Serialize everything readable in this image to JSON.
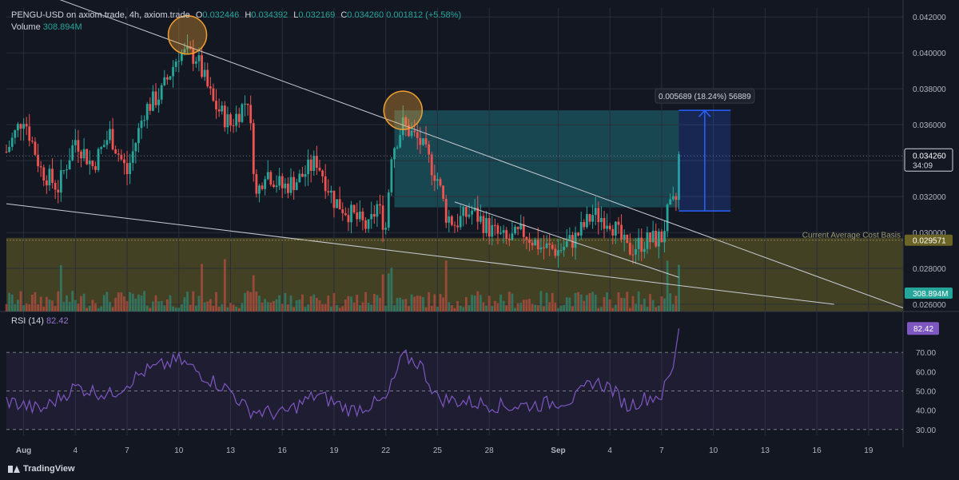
{
  "header": {
    "symbol": "PENGU-USD on axiom.trade, 4h, axiom.trade",
    "o_label": "O",
    "o_value": "0.032446",
    "h_label": "H",
    "h_value": "0.034392",
    "l_label": "L",
    "l_value": "0.032169",
    "c_label": "C",
    "c_value": "0.034260",
    "change_value": "0.001812 (+5.58%)",
    "volume_label": "Volume",
    "volume_value": "308.894M",
    "rsi_label": "RSI (14)",
    "rsi_value": "82.42"
  },
  "brand": {
    "name": "TradingView",
    "icon": "tradingview-logo-icon"
  },
  "colors": {
    "background": "#131722",
    "up": "#26a69a",
    "down": "#ef5350",
    "zone_cyan": "#1f6f78",
    "zone_yellow": "#6b6424",
    "rsi": "#7e57c2",
    "circle": "#f0a030",
    "measure": "#2962ff"
  },
  "chart_data": {
    "type": "candlestick",
    "symbol": "PENGU-USD",
    "interval": "4h",
    "price_axis": {
      "ticks": [
        0.026,
        0.028,
        0.03,
        0.032,
        0.034,
        0.036,
        0.038,
        0.04,
        0.042
      ],
      "tick_labels": [
        "0.026000",
        "0.028000",
        "0.030000",
        "0.032000",
        "0.034000",
        "0.036000",
        "0.038000",
        "0.040000",
        "0.042000"
      ],
      "range": [
        0.0256,
        0.0425
      ]
    },
    "time_axis": {
      "range": [
        "2025-07-31",
        "2025-09-21"
      ],
      "ticks": [
        {
          "date": "2025-08-01",
          "label": "Aug",
          "bold": true
        },
        {
          "date": "2025-08-04",
          "label": "4"
        },
        {
          "date": "2025-08-07",
          "label": "7"
        },
        {
          "date": "2025-08-10",
          "label": "10"
        },
        {
          "date": "2025-08-13",
          "label": "13"
        },
        {
          "date": "2025-08-16",
          "label": "16"
        },
        {
          "date": "2025-08-19",
          "label": "19"
        },
        {
          "date": "2025-08-22",
          "label": "22"
        },
        {
          "date": "2025-08-25",
          "label": "25"
        },
        {
          "date": "2025-08-28",
          "label": "28"
        },
        {
          "date": "2025-09-01",
          "label": "Sep",
          "bold": true
        },
        {
          "date": "2025-09-04",
          "label": "4"
        },
        {
          "date": "2025-09-07",
          "label": "7"
        },
        {
          "date": "2025-09-10",
          "label": "10"
        },
        {
          "date": "2025-09-13",
          "label": "13"
        },
        {
          "date": "2025-09-16",
          "label": "16"
        },
        {
          "date": "2025-09-19",
          "label": "19"
        }
      ]
    },
    "price_path": [
      [
        "2025-07-31",
        0.0345
      ],
      [
        "2025-08-01",
        0.0365
      ],
      [
        "2025-08-02",
        0.0335
      ],
      [
        "2025-08-03",
        0.0325
      ],
      [
        "2025-08-04",
        0.0352
      ],
      [
        "2025-08-05",
        0.0337
      ],
      [
        "2025-08-06",
        0.0355
      ],
      [
        "2025-08-07",
        0.0333
      ],
      [
        "2025-08-08",
        0.0368
      ],
      [
        "2025-08-09",
        0.0378
      ],
      [
        "2025-08-10",
        0.04
      ],
      [
        "2025-08-11",
        0.0398
      ],
      [
        "2025-08-12",
        0.0372
      ],
      [
        "2025-08-13",
        0.036
      ],
      [
        "2025-08-14",
        0.0375
      ],
      [
        "2025-08-14T12",
        0.032
      ],
      [
        "2025-08-15",
        0.0335
      ],
      [
        "2025-08-16",
        0.0325
      ],
      [
        "2025-08-17",
        0.033
      ],
      [
        "2025-08-18",
        0.034
      ],
      [
        "2025-08-19",
        0.0318
      ],
      [
        "2025-08-20",
        0.031
      ],
      [
        "2025-08-21",
        0.0302
      ],
      [
        "2025-08-21T12",
        0.0315
      ],
      [
        "2025-08-22",
        0.0303
      ],
      [
        "2025-08-22T08",
        0.0345
      ],
      [
        "2025-08-23",
        0.036
      ],
      [
        "2025-08-24",
        0.035
      ],
      [
        "2025-08-25",
        0.033
      ],
      [
        "2025-08-25T12",
        0.031
      ],
      [
        "2025-08-26",
        0.0305
      ],
      [
        "2025-08-27",
        0.0312
      ],
      [
        "2025-08-28",
        0.0302
      ],
      [
        "2025-08-29",
        0.0295
      ],
      [
        "2025-08-30",
        0.03
      ],
      [
        "2025-08-31",
        0.0292
      ],
      [
        "2025-09-01",
        0.029
      ],
      [
        "2025-09-02",
        0.0297
      ],
      [
        "2025-09-03",
        0.031
      ],
      [
        "2025-09-04",
        0.0307
      ],
      [
        "2025-09-05",
        0.029
      ],
      [
        "2025-09-06",
        0.0295
      ],
      [
        "2025-09-07",
        0.0297
      ],
      [
        "2025-09-07T08",
        0.031
      ],
      [
        "2025-09-07T20",
        0.0318
      ],
      [
        "2025-09-08",
        0.0342
      ]
    ],
    "volume_last": "308.894M",
    "current_price_label": "0.034260",
    "countdown_label": "34:09",
    "avg_cost_price": 0.029571,
    "avg_cost_label": "0.029571",
    "avg_cost_text": "Current Average Cost Basis",
    "peak_circles": [
      {
        "date": "2025-08-10T12",
        "price": 0.041
      },
      {
        "date": "2025-08-23",
        "price": 0.0368
      }
    ],
    "trendlines": [
      {
        "from": [
          "2025-08-03",
          0.043
        ],
        "to": [
          "2025-09-21",
          0.0258
        ]
      },
      {
        "from": [
          "2025-07-31",
          0.0316
        ],
        "to": [
          "2025-09-17",
          0.026
        ]
      },
      {
        "from": [
          "2025-08-26",
          0.0317
        ],
        "to": [
          "2025-09-08",
          0.0275
        ]
      }
    ],
    "zones": [
      {
        "name": "target",
        "x0": "2025-08-22T12",
        "x1": "2025-09-08",
        "y0": 0.0314,
        "y1": 0.0368
      },
      {
        "name": "avg-cost",
        "x0": "2025-07-31",
        "x1": "2025-09-21",
        "y0": 0.0256,
        "y1": 0.0297
      }
    ],
    "measurement": {
      "label": "0.005689 (18.24%) 56889",
      "from_date": "2025-09-08",
      "to_date": "2025-09-11",
      "low": 0.0312,
      "high": 0.0368
    },
    "rsi": {
      "period": 14,
      "last": 82.42,
      "ticks": [
        30,
        40,
        50,
        60,
        70
      ],
      "tick_labels": [
        "30.00",
        "40.00",
        "50.00",
        "60.00",
        "70.00"
      ],
      "range": [
        27,
        85
      ],
      "bands": [
        30,
        50,
        70
      ],
      "path": [
        [
          "2025-07-31",
          45
        ],
        [
          "2025-08-02",
          40
        ],
        [
          "2025-08-04",
          52
        ],
        [
          "2025-08-06",
          48
        ],
        [
          "2025-08-08",
          60
        ],
        [
          "2025-08-10",
          66
        ],
        [
          "2025-08-12",
          55
        ],
        [
          "2025-08-13",
          50
        ],
        [
          "2025-08-14",
          40
        ],
        [
          "2025-08-16",
          38
        ],
        [
          "2025-08-18",
          48
        ],
        [
          "2025-08-20",
          40
        ],
        [
          "2025-08-22",
          45
        ],
        [
          "2025-08-23",
          68
        ],
        [
          "2025-08-24",
          64
        ],
        [
          "2025-08-25",
          46
        ],
        [
          "2025-08-27",
          44
        ],
        [
          "2025-08-29",
          42
        ],
        [
          "2025-08-31",
          43
        ],
        [
          "2025-09-02",
          46
        ],
        [
          "2025-09-03",
          55
        ],
        [
          "2025-09-04",
          52
        ],
        [
          "2025-09-05",
          42
        ],
        [
          "2025-09-06",
          46
        ],
        [
          "2025-09-07",
          48
        ],
        [
          "2025-09-07T16",
          62
        ],
        [
          "2025-09-08",
          82.42
        ]
      ]
    }
  }
}
